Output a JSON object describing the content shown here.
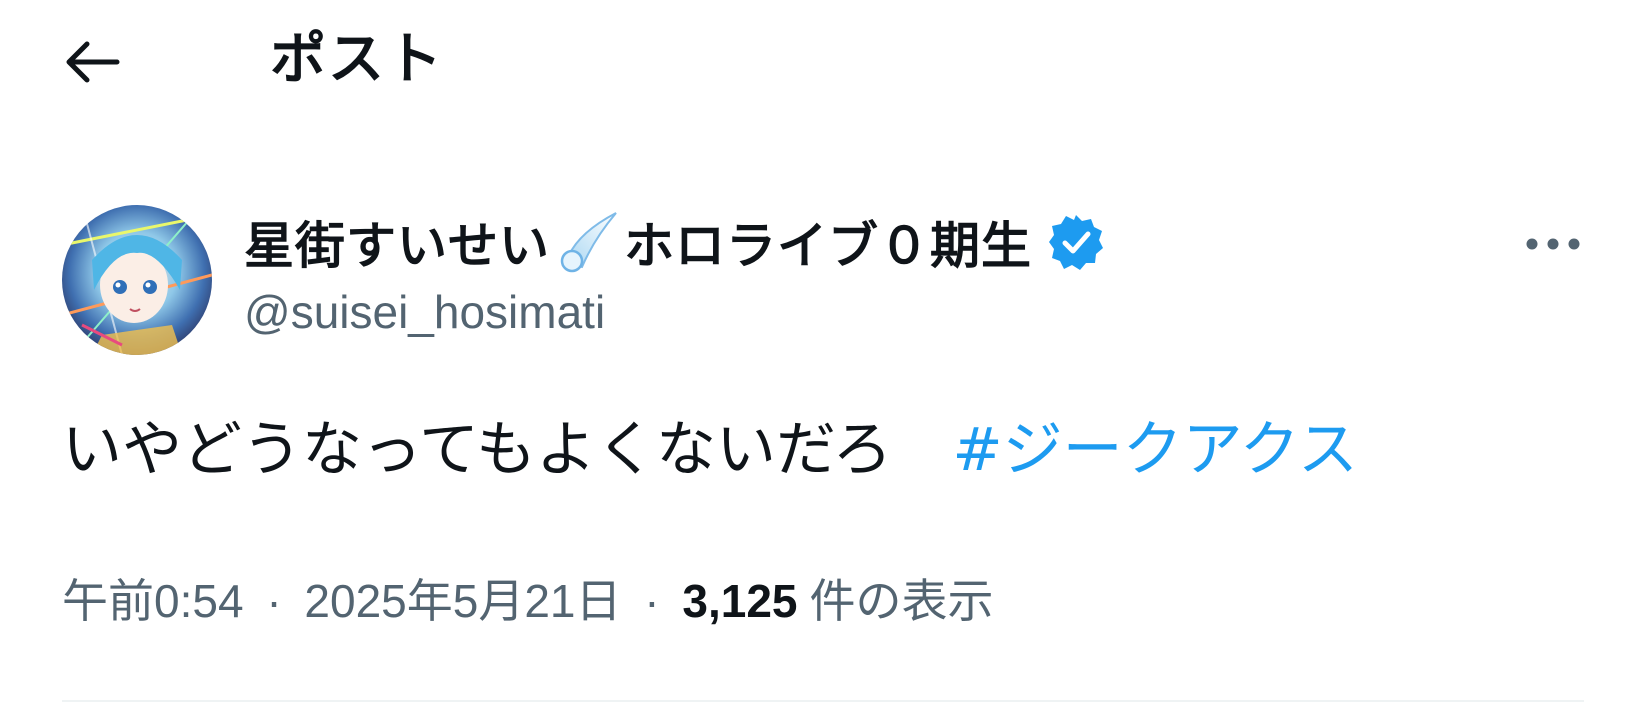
{
  "header": {
    "back_icon": "arrow-left-icon",
    "title": "ポスト"
  },
  "author": {
    "display_name_part1": "星街すいせい",
    "display_name_part2": "ホロライブ０期生",
    "name_emoji": "comet-icon",
    "verified_icon": "verified-badge-icon",
    "handle": "@suisei_hosimati"
  },
  "post": {
    "text": "いやどうなってもよくないだろ",
    "hashtag": "#ジークアクス"
  },
  "meta": {
    "time": "午前0:54",
    "separator": "·",
    "date": "2025年5月21日",
    "view_count": "3,125",
    "view_label": "件の表示"
  },
  "colors": {
    "link": "#1d9bf0",
    "secondary_text": "#536471",
    "primary_text": "#0f1419",
    "verified": "#1d9bf0"
  },
  "more_icon": "more-horizontal-icon"
}
